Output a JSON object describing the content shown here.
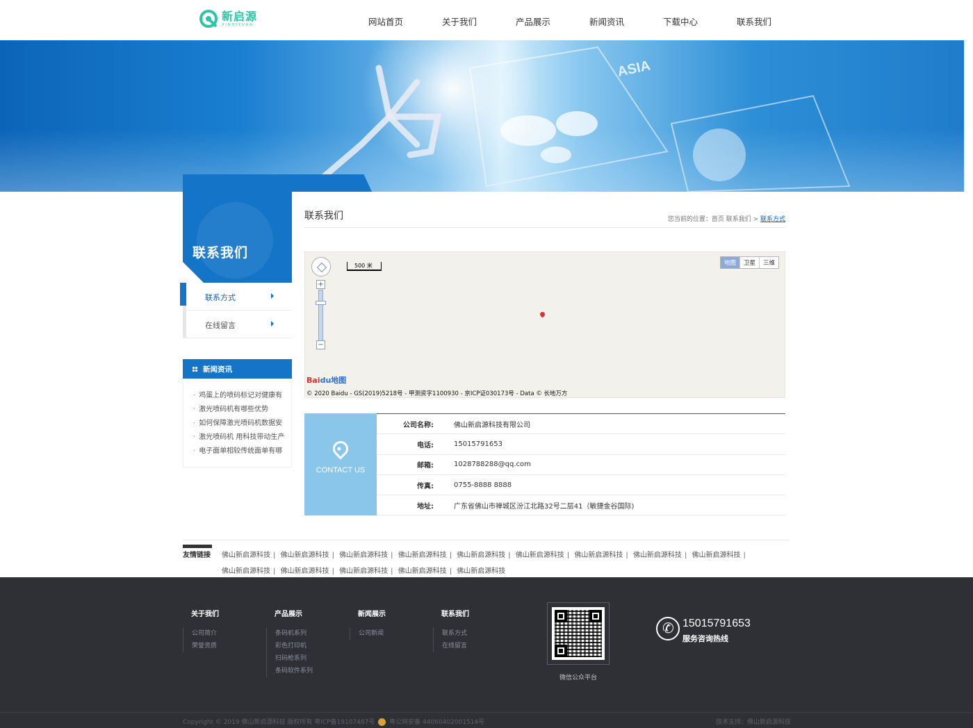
{
  "logo": {
    "cn": "新启源",
    "en": "XINQIYUAN",
    "color": "#2cc6a6"
  },
  "nav": [
    "网站首页",
    "关于我们",
    "产品展示",
    "新闻资讯",
    "下载中心",
    "联系我们"
  ],
  "sidebar": {
    "title": "联系我们",
    "items": [
      {
        "label": "联系方式",
        "active": true
      },
      {
        "label": "在线留言",
        "active": false
      }
    ],
    "news_title": "新闻资讯",
    "news": [
      "鸡蛋上的喷码标记对健康有",
      "激光喷码机有哪些优势",
      "如何保障激光喷码机数据安",
      "激光喷码机 用科技带动生产",
      "电子面单相较传统面单有哪"
    ]
  },
  "main": {
    "title": "联系我们",
    "breadcrumb": {
      "prefix": "您当前的位置：首页 联系我们 >",
      "current": "联系方式"
    }
  },
  "map": {
    "scale_label": "500 米",
    "types": [
      "地图",
      "卫星",
      "三维"
    ],
    "zoom_in": "+",
    "zoom_out": "−",
    "logo_bai": "Bai",
    "logo_du": "du地图",
    "copyright": "© 2020 Baidu - GS(2019)5218号 - 甲测资字1100930 - 京ICP证030173号 - Data © 长地万方"
  },
  "contact": {
    "card_label": "CONTACT US",
    "rows": [
      {
        "k": "公司名称:",
        "v": "佛山新启源科技有限公司"
      },
      {
        "k": "电话:",
        "v": "15015791653"
      },
      {
        "k": "邮箱:",
        "v": "1028788288@qq.com"
      },
      {
        "k": "传真:",
        "v": "0755-8888 8888"
      },
      {
        "k": "地址:",
        "v": "广东省佛山市禅城区汾江北路32号二层41（敏捷金谷国际)"
      }
    ]
  },
  "links": {
    "label": "友情链接",
    "row1": [
      "佛山新启源科技",
      "佛山新启源科技",
      "佛山新启源科技",
      "佛山新启源科技",
      "佛山新启源科技",
      "佛山新启源科技",
      "佛山新启源科技",
      "佛山新启源科技",
      "佛山新启源科技"
    ],
    "row2": [
      "佛山新启源科技",
      "佛山新启源科技",
      "佛山新启源科技",
      "佛山新启源科技",
      "佛山新启源科技"
    ],
    "separator": "|"
  },
  "footer": {
    "cols": [
      {
        "title": "关于我们",
        "items": [
          "公司简介",
          "荣誉资质"
        ]
      },
      {
        "title": "产品展示",
        "items": [
          "条码机系列",
          "彩色打印机",
          "扫码枪系列",
          "条码软件系列"
        ]
      },
      {
        "title": "新闻展示",
        "items": [
          "公司新闻"
        ]
      },
      {
        "title": "联系我们",
        "items": [
          "联系方式",
          "在线留言"
        ]
      }
    ],
    "qr_label": "微信公众平台",
    "hotline_number": "15015791653",
    "hotline_label": "服务咨询热线",
    "copyright_a": "Copyright © 2019 佛山新启源科技 版权所有 粤ICP备19107487号",
    "copyright_b": "粤公网安备 44060402001514号",
    "tech": "技术支持：佛山新启源科技"
  }
}
